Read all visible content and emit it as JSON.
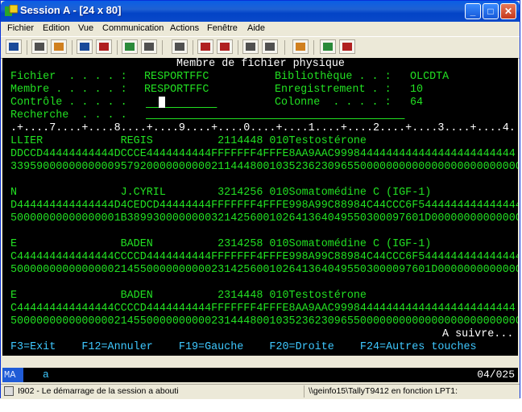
{
  "window": {
    "title": "Session A - [24 x 80]"
  },
  "menu": [
    "Fichier",
    "Edition",
    "Vue",
    "Communication",
    "Actions",
    "Fenêtre",
    "Aide"
  ],
  "screen": {
    "heading": "Membre de fichier physique",
    "fields": {
      "fichier_label": "Fichier  . . . . :",
      "fichier_value": "RESPORTFFC",
      "bibliotheque_label": "Bibliothèque . . :",
      "bibliotheque_value": "OLCDTA",
      "membre_label": "Membre . . . . . :",
      "membre_value": "RESPORTFFC",
      "enregistrement_label": "Enregistrement . :",
      "enregistrement_value": "10",
      "controle_label": "Contrôle . . . . .",
      "colonne_label": "Colonne  . . . . :",
      "colonne_value": "64",
      "recherche_label": "Recherche  . . . ."
    },
    "ruler": ".+....7....+....8....+....9....+....0....+....1....+....2....+....3....+....4.",
    "records": [
      {
        "text": "LLIER            REGIS          2114448 010Testostérone",
        "hex1": "DDCCD44444444444DCCCE4444444444FFFFFFF4FFFE8AA9AAC9998444444444444444444444444",
        "hex2": "3395900000000000957920000000000211444800103523623096550000000000000000000000000"
      },
      {
        "text": "N                J.CYRIL        3214256 010Somatomédine C (IGF-1)",
        "hex1": "D444444444444444D4CEDCD44444444FFFFFFF4FFFE998A99C88984C44CCC6F5444444444444444",
        "hex2": "50000000000000001B3899300000000321425600102641364049550300097601D00000000000000"
      },
      {
        "text": "E                BADEN          2314258 010Somatomédine C (IGF-1)",
        "hex1": "C444444444444444CCCCD4444444444FFFFFFF4FFFE998A99C88984C44CCC6F5444444444444444",
        "hex2": "50000000000000002145500000000002314256001026413640495503000097601D0000000000000"
      },
      {
        "text": "E                BADEN          2314448 010Testostérone",
        "hex1": "C444444444444444CCCCD4444444444FFFFFFF4FFFE8AA9AAC9998444444444444444444444444",
        "hex2": "5000000000000000214550000000000231444800103523623096550000000000000000000000000"
      }
    ],
    "more": "A suivre...",
    "function_keys": "F3=Exit    F12=Annuler    F19=Gauche    F20=Droite    F24=Autres touches"
  },
  "oia": {
    "indicator": "MA",
    "mode": "a",
    "position": "04/025"
  },
  "status": {
    "message": "I902 - Le démarrage de la session a abouti",
    "connection": "\\\\geinfo15\\TallyT9412 en fonction LPT1:"
  }
}
